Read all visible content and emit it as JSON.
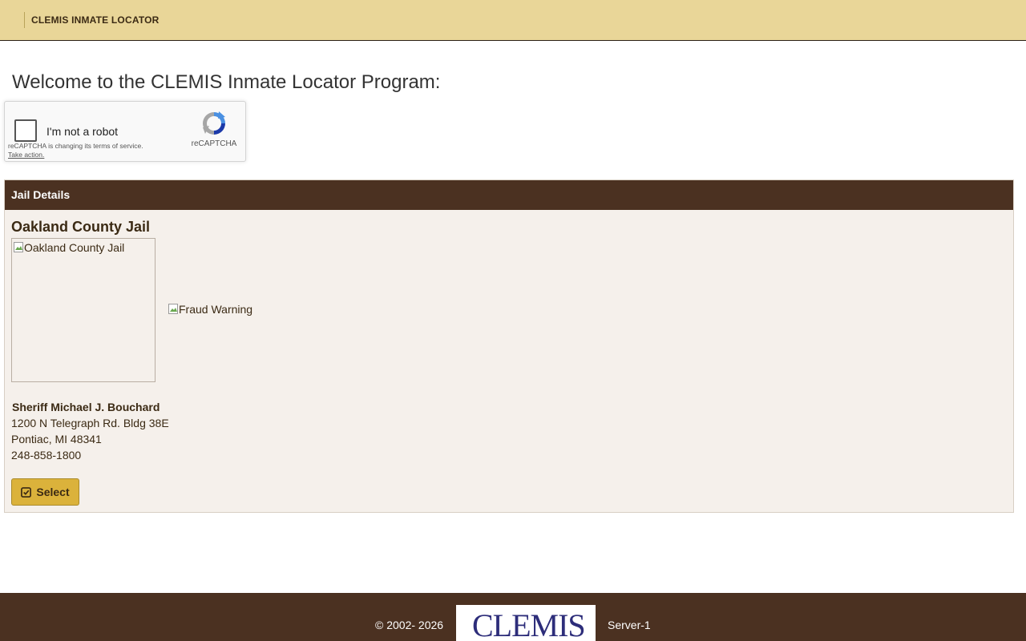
{
  "header": {
    "brand": "CLEMIS INMATE LOCATOR"
  },
  "welcome": "Welcome to the CLEMIS Inmate Locator Program:",
  "recaptcha": {
    "label": "I'm not a robot",
    "terms": "reCAPTCHA is changing its terms of service.",
    "take_action": "Take action.",
    "brand": "reCAPTCHA",
    "checked": false
  },
  "panel": {
    "title": "Jail Details",
    "jail_name": "Oakland County Jail",
    "jail_image_alt": "Oakland County Jail",
    "fraud_alt": "Fraud Warning",
    "sheriff": "Sheriff Michael J. Bouchard",
    "address_line1": "1200 N Telegraph Rd. Bldg 38E",
    "address_line2": "Pontiac, MI 48341",
    "phone": "248-858-1800",
    "select_label": "Select"
  },
  "footer": {
    "copyright": "© 2002- 2026",
    "logo_text": "CLEMIS",
    "server": "Server-1"
  },
  "colors": {
    "topbar": "#e9d698",
    "brown": "#4b3121",
    "panel_bg": "#f5f0eb",
    "button": "#dbb23b"
  }
}
